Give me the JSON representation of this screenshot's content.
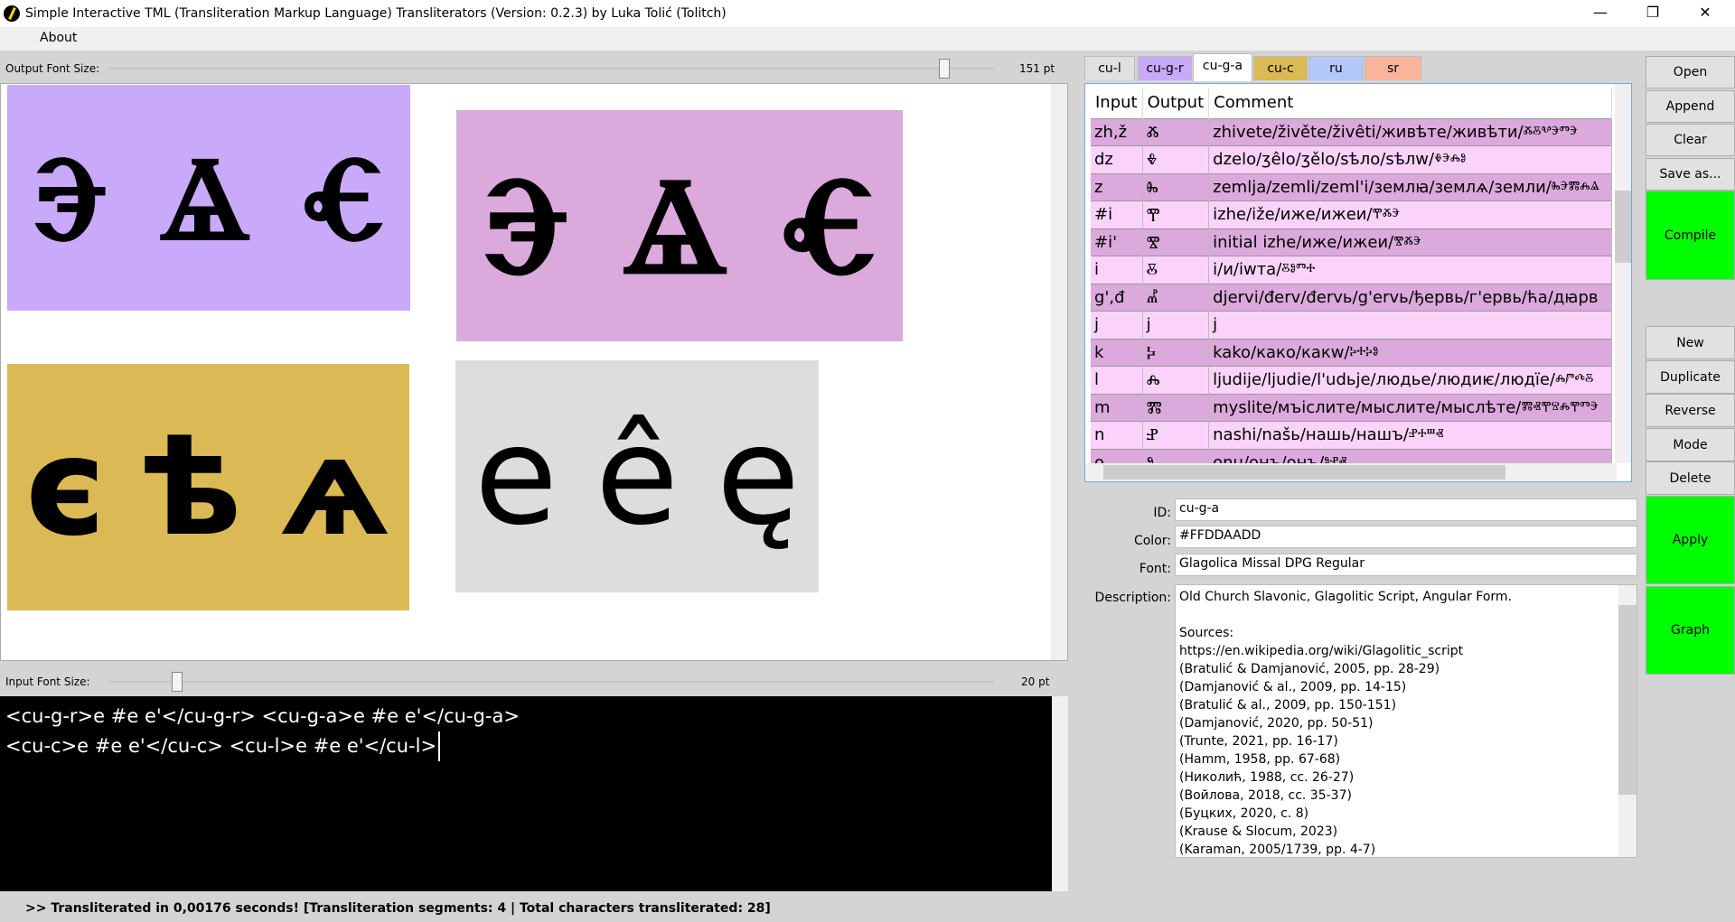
{
  "window": {
    "title": "Simple Interactive TML (Transliteration Markup Language) Transliterators (Version: 0.2.3) by Luka Tolić (Tolitch)",
    "minimize": "—",
    "maximize": "❐",
    "close": "✕"
  },
  "menu": {
    "about": "About"
  },
  "output_font": {
    "label": "Output Font Size:",
    "value": "151 pt",
    "slider_fraction": 0.93
  },
  "input_font": {
    "label": "Input Font Size:",
    "value": "20 pt",
    "slider_fraction": 0.08
  },
  "preview": [
    {
      "id": "cu-g-r",
      "color": "#c9a9fa",
      "glyphs": [
        "Ⰵ",
        "Ⱑ",
        "Ⱔ"
      ]
    },
    {
      "id": "cu-g-a",
      "color": "#dba9db",
      "glyphs": [
        "Ⰵ",
        "Ⱑ",
        "Ⱔ"
      ]
    },
    {
      "id": "cu-c",
      "color": "#dbb954",
      "glyphs": [
        "є",
        "ѣ",
        "ѧ"
      ]
    },
    {
      "id": "cu-l",
      "color": "#dddddd",
      "glyphs": [
        "e",
        "ê",
        "ę"
      ]
    }
  ],
  "input_text": {
    "line1": "<cu-g-r>e #e e'</cu-g-r> <cu-g-a>e #e e'</cu-g-a>",
    "line2": "<cu-c>e #e e'</cu-c> <cu-l>e #e e'</cu-l>"
  },
  "status": ">> Transliterated in 0,00176 seconds! [Transliteration segments: 4 | Total characters transliterated: 28]",
  "tabs": [
    {
      "label": "cu-l",
      "color": "#e0e0e0"
    },
    {
      "label": "cu-g-r",
      "color": "#c9a9fa"
    },
    {
      "label": "cu-g-a",
      "color": "#ffffff",
      "active": true
    },
    {
      "label": "cu-c",
      "color": "#dbb954"
    },
    {
      "label": "ru",
      "color": "#b4c8fa"
    },
    {
      "label": "sr",
      "color": "#fab49b"
    }
  ],
  "table": {
    "headers": [
      "Input",
      "Output",
      "Comment"
    ],
    "rows": [
      [
        "zh,ž",
        "Ⰶ",
        "zhivete/živěte/živêti/живѣте/живѣти/ⰶⰻⰲⰵⱅⰵ"
      ],
      [
        "dz",
        "Ⰷ",
        "dzelo/ʒêlo/ʒělo/sѣлo/sѣлw/ⰷⰵⰾⱁ"
      ],
      [
        "z",
        "Ⰸ",
        "zemlja/zemli/zeml'i/землꙗ/землѧ/земли/ⰸⰵⰿⰾⱑ"
      ],
      [
        "#i",
        "Ⰹ",
        "izhe/iže/иже/ижеи/ⰹⰶⰵ"
      ],
      [
        "#i'",
        "Ⰺ",
        "initial izhe/иже/ижеи/ⰺⰶⰵ"
      ],
      [
        "i",
        "Ⰻ",
        "i/и/iwта/ⰻⱁⱅⰰ"
      ],
      [
        "g',đ",
        "Ⰼ",
        "djervi/đerv/đervь/g'ervь/ђервь/г'ервь/ћa/дꙗрв"
      ],
      [
        "j",
        "j",
        "j"
      ],
      [
        "k",
        "Ⰽ",
        "kako/како/какw/ⰽⰰⰽⱁ"
      ],
      [
        "l",
        "Ⰾ",
        "ljudije/ljudie/l'udьje/людье/людиѥ/людїе/ⰾⱓⰴⰻ"
      ],
      [
        "m",
        "Ⰿ",
        "myslite/мъіслите/мыслите/мыслѣте/ⰿⱏⰹⱄⰾⰹⱅⰵ"
      ],
      [
        "n",
        "Ⱀ",
        "nashi/našь/нашь/нашъ/ⱀⰰⱎⱏ"
      ],
      [
        "o",
        "Ⱁ",
        "onu/онъ/онъ/ⱁⱀⱏ"
      ]
    ]
  },
  "details": {
    "id_label": "ID:",
    "id": "cu-g-a",
    "color_label": "Color:",
    "color": "#FFDDAADD",
    "font_label": "Font:",
    "font": "Glagolica Missal DPG Regular",
    "desc_label": "Description:",
    "description": "Old Church Slavonic, Glagolitic Script, Angular Form.\n\nSources:\nhttps://en.wikipedia.org/wiki/Glagolitic_script\n(Bratulić & Damjanović, 2005, pp. 28-29)\n(Damjanović & al., 2009, pp. 14-15)\n(Bratulić & al., 2009, pp. 150-151)\n(Damjanović, 2020, pp. 50-51)\n(Trunte, 2021, pp. 16-17)\n(Hamm, 1958, pp. 67-68)\n(Николић, 1988, сс. 26-27)\n(Войлова, 2018, сс. 35-37)\n(Буцких, 2020, с. 8)\n(Krause & Slocum, 2023)\n(Karaman, 2005/1739, pp. 4-7)"
  },
  "buttons": {
    "open": "Open",
    "append": "Append",
    "clear": "Clear",
    "save_as": "Save as...",
    "compile": "Compile",
    "new": "New",
    "duplicate": "Duplicate",
    "reverse": "Reverse",
    "mode": "Mode",
    "delete": "Delete",
    "apply": "Apply",
    "graph": "Graph"
  },
  "accent_green": "#00ff00"
}
